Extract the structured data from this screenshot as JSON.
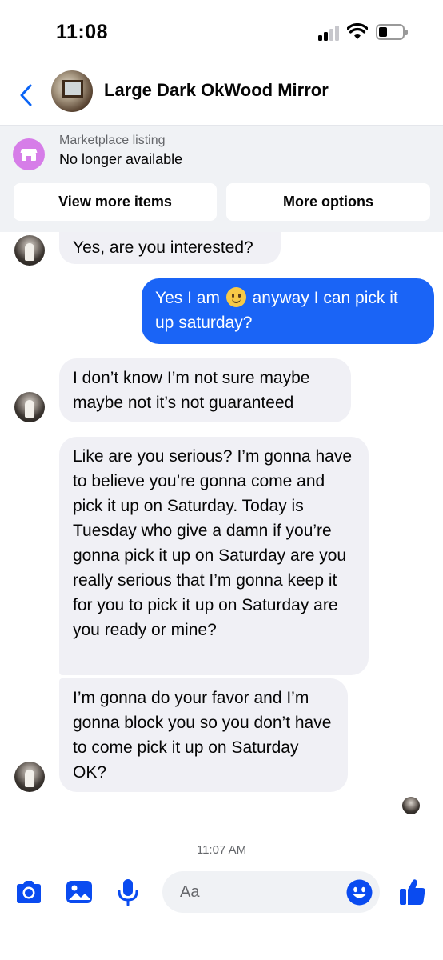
{
  "status_bar": {
    "time": "11:08"
  },
  "header": {
    "title": "Large Dark OkWood Mirror"
  },
  "marketplace": {
    "label": "Marketplace listing",
    "status": "No longer available",
    "buttons": [
      "View more items",
      "More options"
    ]
  },
  "messages": [
    {
      "from": "seller",
      "text": "Yes, are you interested?"
    },
    {
      "from": "me",
      "text_before": "Yes I am",
      "emoji": "slightly-smiling-face",
      "text_after": "anyway I can pick it up saturday?"
    },
    {
      "from": "seller",
      "text": "I don’t know I’m not sure maybe maybe not it’s not guaranteed"
    },
    {
      "from": "seller",
      "text": "Like are you serious? I’m gonna have to believe you’re gonna come and pick it up on Saturday. Today is Tuesday who give a damn if you’re gonna pick it up on Saturday are you really serious that I’m gonna keep it for you to pick it up on Saturday are you ready or mine?"
    },
    {
      "from": "seller",
      "text": "I’m gonna do your favor and I’m gonna block you so you don’t have to come pick it up on Saturday OK?"
    }
  ],
  "timestamp": "11:07 AM",
  "composer": {
    "placeholder": "Aa",
    "icons": [
      "camera-icon",
      "photo-icon",
      "microphone-icon",
      "emoji-icon",
      "thumbs-up-icon"
    ]
  },
  "colors": {
    "accent": "#0a4bf0",
    "outgoing_bubble": "#1a64f6",
    "incoming_bubble": "#f0f0f5",
    "marketplace_icon": "#d67de8"
  }
}
